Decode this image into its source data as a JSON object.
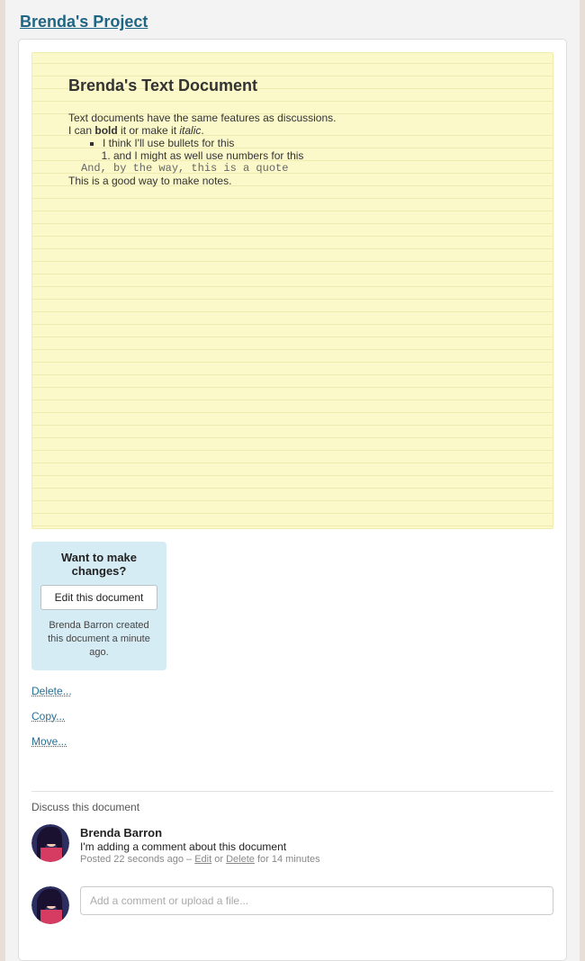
{
  "project": {
    "title": "Brenda's Project"
  },
  "document": {
    "title": "Brenda's Text Document",
    "intro_line": "Text documents have the same features as discussions.",
    "format_line_prefix": "I can ",
    "format_line_bold": "bold",
    "format_line_mid": " it or make it ",
    "format_line_italic": "italic",
    "format_line_suffix": ".",
    "bullet_1": "I think I'll use bullets for this",
    "number_1": "and I might as well use numbers for this",
    "quote_line": "And, by the way, this is a quote",
    "closing_line": "This is a good way to make notes."
  },
  "sidebar": {
    "changes_heading": "Want to make changes?",
    "edit_button": "Edit this document",
    "created_meta": "Brenda Barron created this document a minute ago.",
    "links": {
      "delete": "Delete...",
      "copy": "Copy...",
      "move": "Move..."
    }
  },
  "discussion": {
    "heading": "Discuss this document",
    "comment": {
      "author": "Brenda Barron",
      "text": "I'm adding a comment about this document",
      "meta_prefix": "Posted 22 seconds ago – ",
      "edit_label": "Edit",
      "meta_or": " or ",
      "delete_label": "Delete",
      "meta_suffix": " for 14 minutes"
    },
    "input_placeholder": "Add a comment or upload a file..."
  }
}
